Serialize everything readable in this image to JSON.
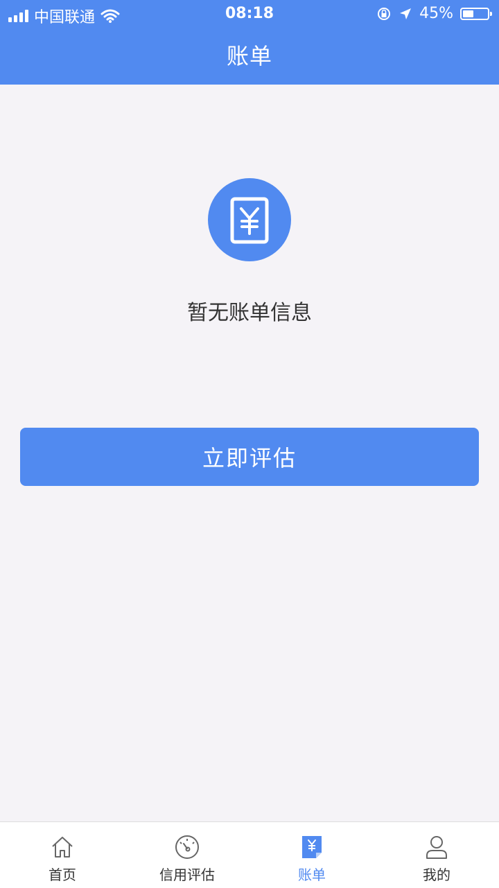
{
  "status_bar": {
    "carrier": "中国联通",
    "time": "08:18",
    "battery_percent": "45%",
    "battery_level": 0.45
  },
  "nav": {
    "title": "账单"
  },
  "empty_state": {
    "icon": "bill-yuan-icon",
    "message": "暂无账单信息"
  },
  "actions": {
    "evaluate_label": "立即评估"
  },
  "tab_bar": {
    "items": [
      {
        "label": "首页",
        "icon": "home-icon"
      },
      {
        "label": "信用评估",
        "icon": "gauge-icon"
      },
      {
        "label": "账单",
        "icon": "bill-icon"
      },
      {
        "label": "我的",
        "icon": "user-icon"
      }
    ],
    "active_index": 2
  },
  "colors": {
    "primary": "#518af0",
    "background": "#f5f3f7",
    "text": "#333333"
  }
}
